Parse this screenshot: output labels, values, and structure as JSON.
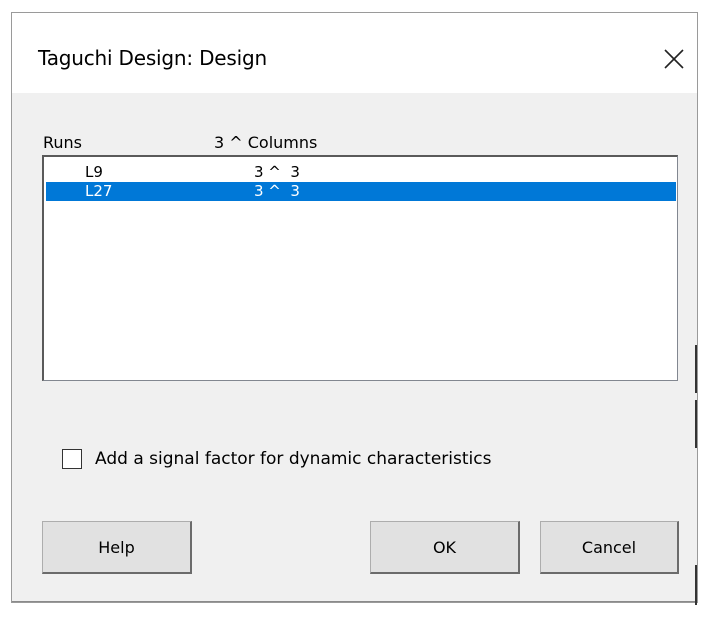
{
  "dialog": {
    "title": "Taguchi Design: Design",
    "close_icon": "close-x-icon"
  },
  "list": {
    "headers": {
      "runs": "Runs",
      "columns": "3 ^ Columns"
    },
    "rows": [
      {
        "runs": "L9",
        "columns": "3 ^  3",
        "selected": false
      },
      {
        "runs": "L27",
        "columns": "3 ^  3",
        "selected": true
      }
    ],
    "selection_color": "#0078d7"
  },
  "options": {
    "signal_factor_label": "Add a signal factor for dynamic characteristics",
    "signal_factor_checked": false
  },
  "buttons": {
    "help": "Help",
    "ok": "OK",
    "cancel": "Cancel"
  }
}
